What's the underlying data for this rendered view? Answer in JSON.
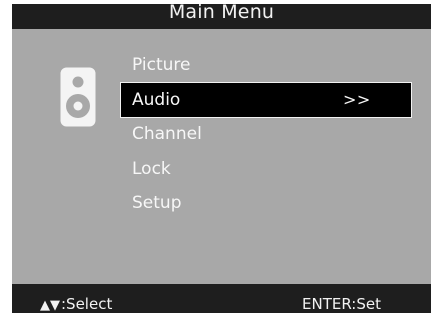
{
  "title": "Main Menu",
  "menu": {
    "items": [
      {
        "label": "Picture",
        "arrow": ""
      },
      {
        "label": "Audio",
        "arrow": ">>"
      },
      {
        "label": "Channel",
        "arrow": ""
      },
      {
        "label": "Lock",
        "arrow": ""
      },
      {
        "label": "Setup",
        "arrow": ""
      }
    ],
    "selected_index": 1
  },
  "category_icon": "speaker-icon",
  "footer": {
    "nav_keys": "▲▼",
    "nav_label": ":Select",
    "enter_label": "ENTER:Set"
  },
  "colors": {
    "panel_background": "#a8a8a8",
    "bar_background": "#1e1e1e",
    "selected_background": "#000000",
    "text": "#f7f7f7"
  }
}
